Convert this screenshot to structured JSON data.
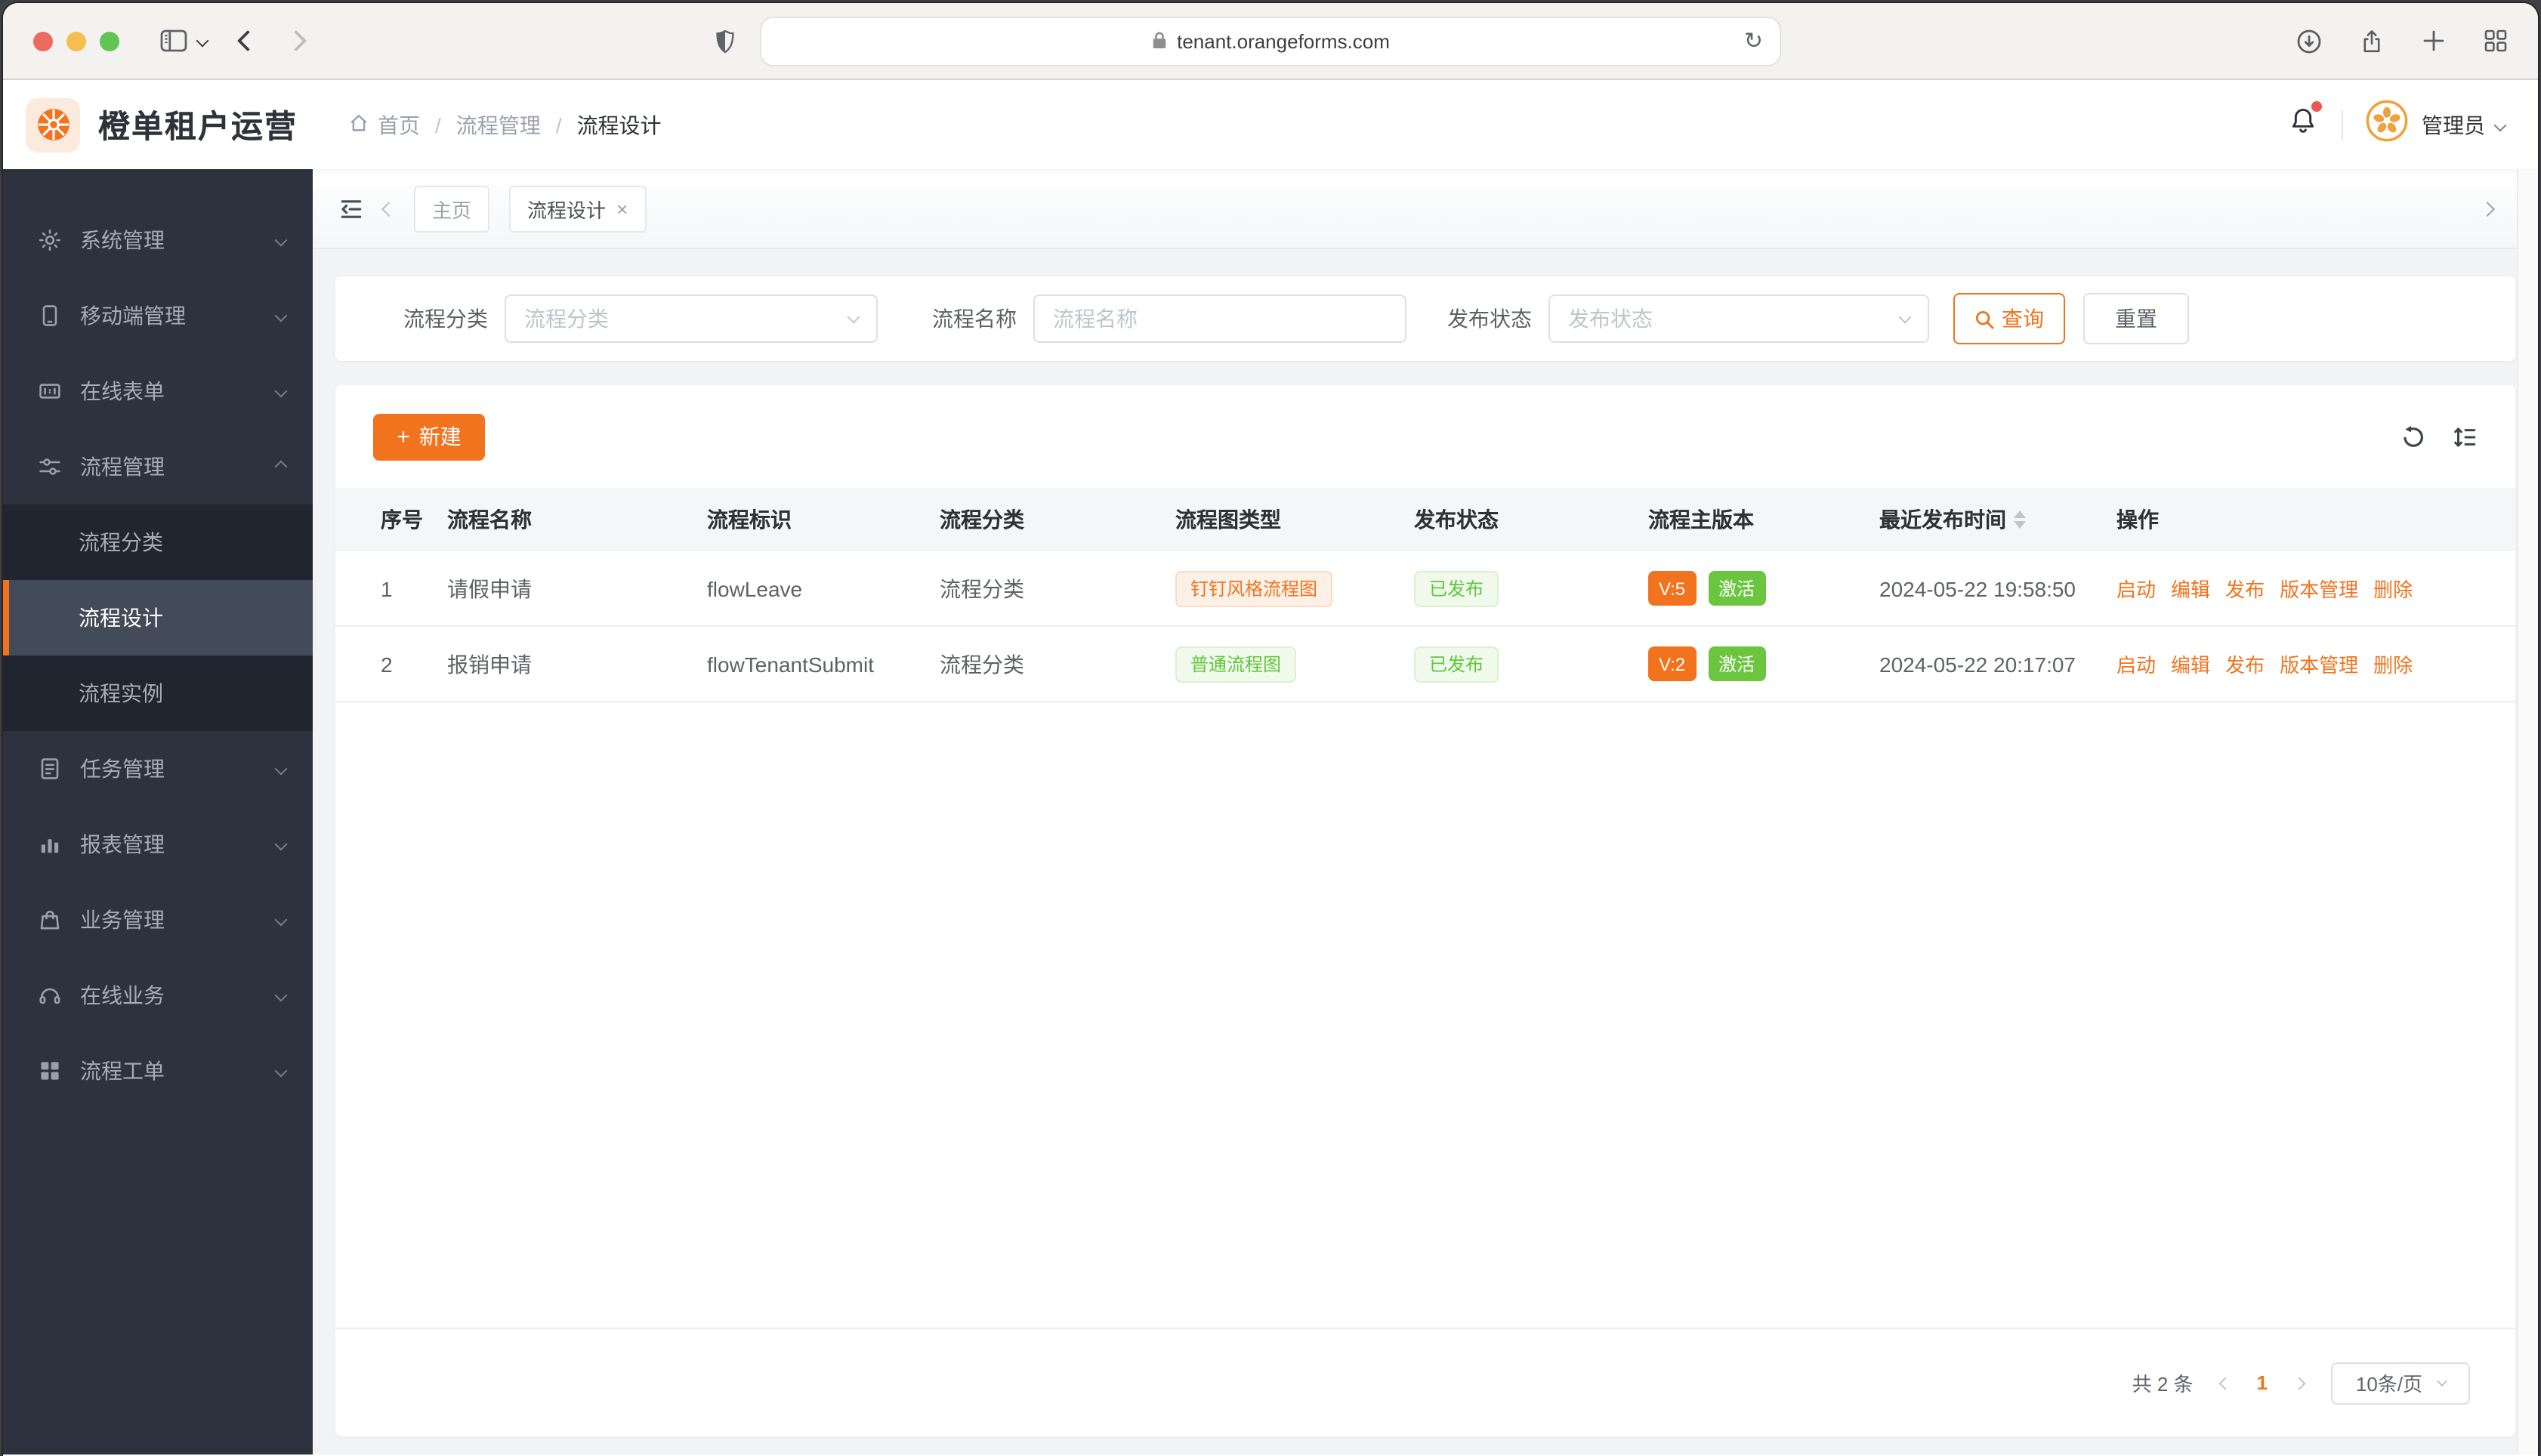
{
  "browser": {
    "url": "tenant.orangeforms.com"
  },
  "icons": {
    "reload": "↻",
    "plus": "+",
    "close": "×",
    "down_arrow": "↓"
  },
  "app_header": {
    "title": "橙单租户运营",
    "breadcrumb": [
      {
        "label": "首页"
      },
      {
        "label": "流程管理"
      },
      {
        "label": "流程设计"
      }
    ],
    "user": {
      "name": "管理员"
    }
  },
  "tab_bar": {
    "tabs": [
      {
        "label": "主页",
        "active": false,
        "closable": false
      },
      {
        "label": "流程设计",
        "active": true,
        "closable": true
      }
    ]
  },
  "sidebar": {
    "items": [
      {
        "label": "系统管理",
        "icon": "gear-icon",
        "expanded": false
      },
      {
        "label": "移动端管理",
        "icon": "mobile-icon",
        "expanded": false
      },
      {
        "label": "在线表单",
        "icon": "form-icon",
        "expanded": false
      },
      {
        "label": "流程管理",
        "icon": "sliders-icon",
        "expanded": true,
        "children": [
          {
            "label": "流程分类",
            "active": false
          },
          {
            "label": "流程设计",
            "active": true
          },
          {
            "label": "流程实例",
            "active": false
          }
        ]
      },
      {
        "label": "任务管理",
        "icon": "tasks-icon",
        "expanded": false
      },
      {
        "label": "报表管理",
        "icon": "bar-chart-icon",
        "expanded": false
      },
      {
        "label": "业务管理",
        "icon": "bag-icon",
        "expanded": false
      },
      {
        "label": "在线业务",
        "icon": "headset-icon",
        "expanded": false
      },
      {
        "label": "流程工单",
        "icon": "grid-icon",
        "expanded": false
      }
    ]
  },
  "filters": {
    "category": {
      "label": "流程分类",
      "placeholder": "流程分类"
    },
    "name": {
      "label": "流程名称",
      "placeholder": "流程名称"
    },
    "status": {
      "label": "发布状态",
      "placeholder": "发布状态"
    },
    "search_button": "查询",
    "reset_button": "重置"
  },
  "toolbar": {
    "new_button": "新建"
  },
  "table": {
    "columns": [
      "序号",
      "流程名称",
      "流程标识",
      "流程分类",
      "流程图类型",
      "发布状态",
      "流程主版本",
      "最近发布时间",
      "操作"
    ],
    "actions": [
      "启动",
      "编辑",
      "发布",
      "版本管理",
      "删除"
    ],
    "rows": [
      {
        "index": "1",
        "name": "请假申请",
        "key": "flowLeave",
        "category": "流程分类",
        "diagram_type": "钉钉风格流程图",
        "diagram_tag_style": "orange",
        "publish_status": "已发布",
        "version": "V:5",
        "active_status": "激活",
        "publish_time": "2024-05-22 19:58:50"
      },
      {
        "index": "2",
        "name": "报销申请",
        "key": "flowTenantSubmit",
        "category": "流程分类",
        "diagram_type": "普通流程图",
        "diagram_tag_style": "green",
        "publish_status": "已发布",
        "version": "V:2",
        "active_status": "激活",
        "publish_time": "2024-05-22 20:17:07"
      }
    ]
  },
  "pagination": {
    "total": "共 2 条",
    "current_page": "1",
    "page_size": "10条/页"
  },
  "colors": {
    "accent_orange": "#F2731D",
    "success_green": "#6CC53F",
    "sidebar_bg": "#2D323E",
    "content_bg": "#F2F3F5"
  }
}
